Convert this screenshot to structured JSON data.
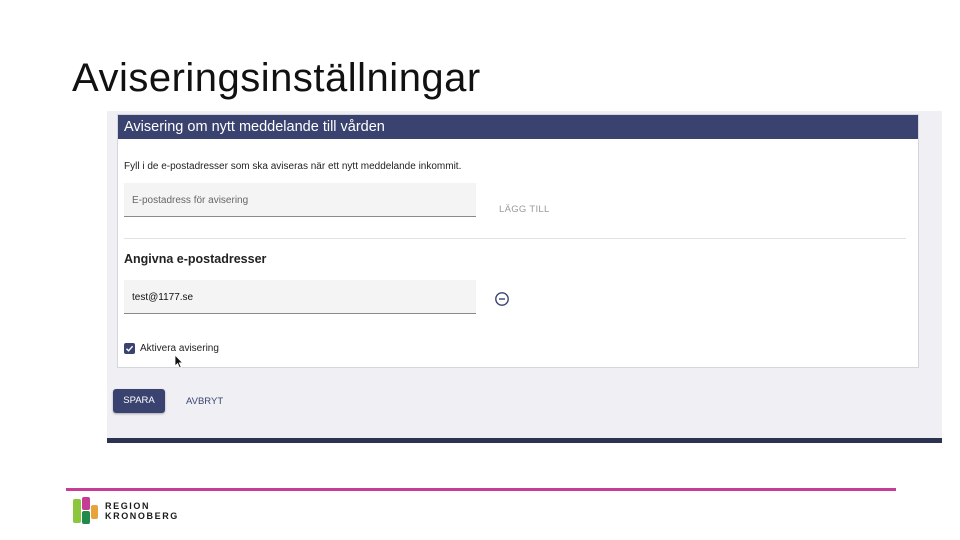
{
  "slide": {
    "title": "Aviseringsinställningar"
  },
  "card": {
    "header": "Avisering om nytt meddelande till vården",
    "instruction": "Fyll i de e-postadresser som ska aviseras när ett nytt meddelande inkommit.",
    "email_input": {
      "placeholder": "E-postadress för avisering",
      "value": ""
    },
    "add_label": "LÄGG TILL",
    "section_heading": "Angivna e-postadresser",
    "entered_email": "test@1177.se",
    "checkbox_label": "Aktivera avisering",
    "checkbox_checked": true
  },
  "actions": {
    "save_label": "SPARA",
    "cancel_label": "AVBRYT"
  },
  "branding": {
    "line1": "REGION",
    "line2": "KRONOBERG"
  },
  "colors": {
    "accent": "#3a4370",
    "footer_line": "#c53d95"
  },
  "icons": {
    "remove": "minus-circle-icon",
    "check": "check-icon",
    "cursor": "mouse-pointer-icon"
  }
}
